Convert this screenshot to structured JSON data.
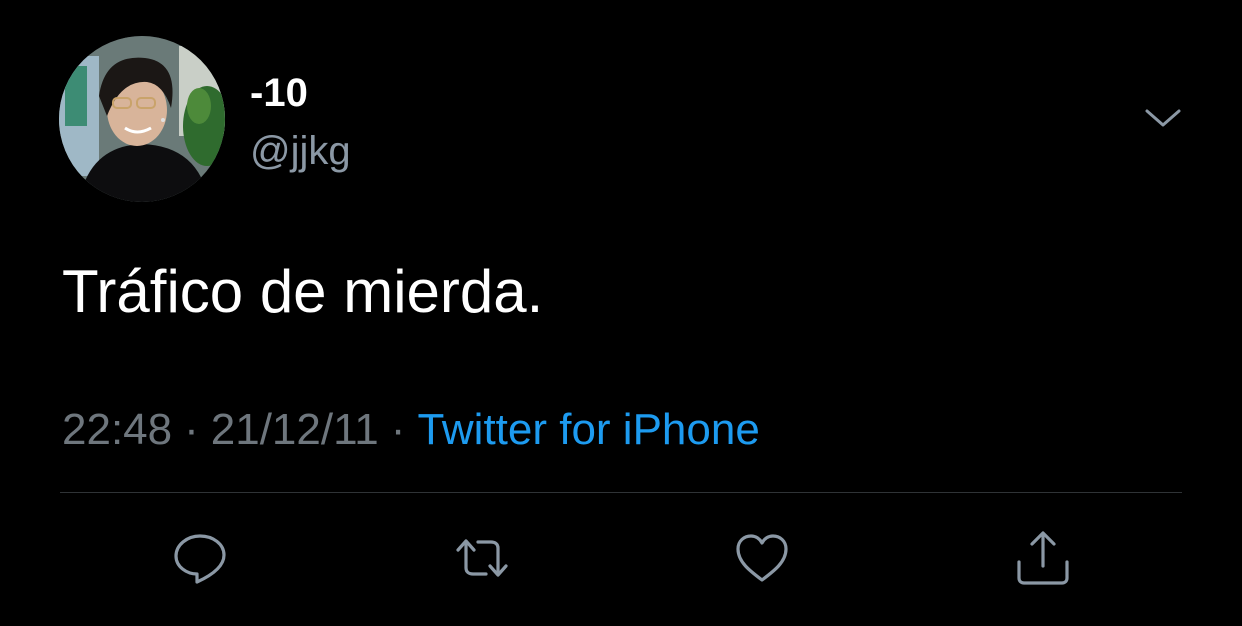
{
  "tweet": {
    "display_name": "-10",
    "handle": "@jjkg",
    "text": "Tráfico de mierda.",
    "time": "22:48",
    "separator": "·",
    "date": "21/12/11",
    "source": "Twitter for iPhone"
  },
  "icons": {
    "more": "chevron-down-icon",
    "reply": "speech-bubble-icon",
    "retweet": "retweet-icon",
    "like": "heart-icon",
    "share": "share-upload-icon"
  },
  "colors": {
    "background": "#000000",
    "primary_text": "#ffffff",
    "secondary_text": "#6e767d",
    "link": "#1d9bf0",
    "divider": "#2f3336",
    "icon": "#8b98a5"
  }
}
